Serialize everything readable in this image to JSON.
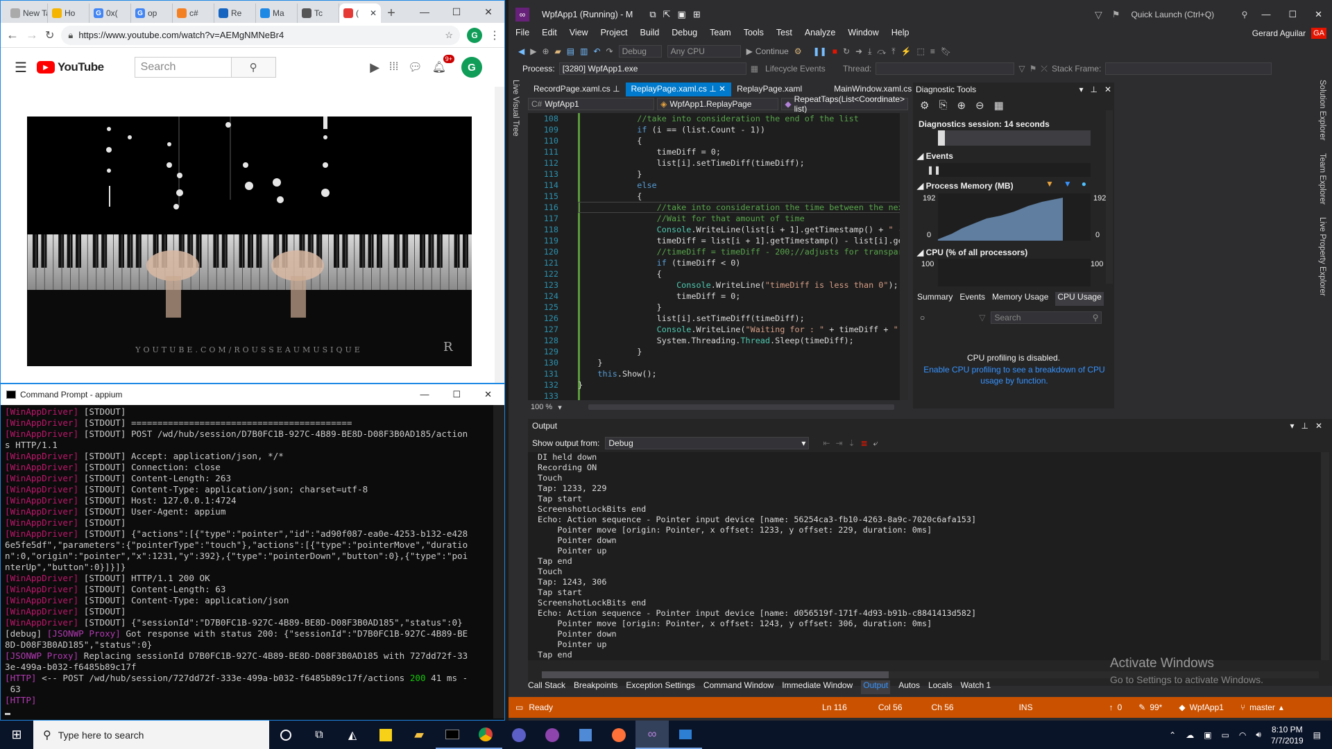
{
  "chrome": {
    "tabs": [
      "New Ta",
      "Ho",
      "0x(",
      "op",
      "c#",
      "Re",
      "Ma",
      "Tc",
      "("
    ],
    "url": "https://www.youtube.com/watch?v=AEMgNMNeBr4",
    "profile_letter": "G"
  },
  "youtube": {
    "logo_text": "YouTube",
    "search_placeholder": "Search",
    "notif_badge": "9+",
    "avatar": "G",
    "video_watermark": "YOUTUBE.COM/ROUSSEAUMUSIQUE"
  },
  "cmd": {
    "title": "Command Prompt - appium",
    "lines": [
      {
        "p": "[WinAppDriver]",
        "t": " [STDOUT]"
      },
      {
        "p": "[WinAppDriver]",
        "t": " [STDOUT] =========================================="
      },
      {
        "p": "[WinAppDriver]",
        "t": " [STDOUT] POST /wd/hub/session/D7B0FC1B-927C-4B89-BE8D-D08F3B0AD185/action"
      },
      {
        "p": "",
        "t": "s HTTP/1.1"
      },
      {
        "p": "[WinAppDriver]",
        "t": " [STDOUT] Accept: application/json, */*"
      },
      {
        "p": "[WinAppDriver]",
        "t": " [STDOUT] Connection: close"
      },
      {
        "p": "[WinAppDriver]",
        "t": " [STDOUT] Content-Length: 263"
      },
      {
        "p": "[WinAppDriver]",
        "t": " [STDOUT] Content-Type: application/json; charset=utf-8"
      },
      {
        "p": "[WinAppDriver]",
        "t": " [STDOUT] Host: 127.0.0.1:4724"
      },
      {
        "p": "[WinAppDriver]",
        "t": " [STDOUT] User-Agent: appium"
      },
      {
        "p": "[WinAppDriver]",
        "t": " [STDOUT]"
      },
      {
        "p": "[WinAppDriver]",
        "t": " [STDOUT] {\"actions\":[{\"type\":\"pointer\",\"id\":\"ad90f087-ea0e-4253-b132-e428"
      },
      {
        "p": "",
        "t": "6e5fe5df\",\"parameters\":{\"pointerType\":\"touch\"},\"actions\":[{\"type\":\"pointerMove\",\"duratio"
      },
      {
        "p": "",
        "t": "n\":0,\"origin\":\"pointer\",\"x\":1231,\"y\":392},{\"type\":\"pointerDown\",\"button\":0},{\"type\":\"poi"
      },
      {
        "p": "",
        "t": "nterUp\",\"button\":0}]}]}"
      },
      {
        "p": "[WinAppDriver]",
        "t": " [STDOUT] HTTP/1.1 200 OK"
      },
      {
        "p": "[WinAppDriver]",
        "t": " [STDOUT] Content-Length: 63"
      },
      {
        "p": "[WinAppDriver]",
        "t": " [STDOUT] Content-Type: application/json"
      },
      {
        "p": "[WinAppDriver]",
        "t": " [STDOUT]"
      },
      {
        "p": "[WinAppDriver]",
        "t": " [STDOUT] {\"sessionId\":\"D7B0FC1B-927C-4B89-BE8D-D08F3B0AD185\",\"status\":0}"
      },
      {
        "p": "[debug]",
        "q": " [JSONWP Proxy]",
        "t": " Got response with status 200: {\"sessionId\":\"D7B0FC1B-927C-4B89-BE"
      },
      {
        "p": "",
        "t": "8D-D08F3B0AD185\",\"status\":0}"
      },
      {
        "p": "",
        "q": "[JSONWP Proxy]",
        "t": " Replacing sessionId D7B0FC1B-927C-4B89-BE8D-D08F3B0AD185 with 727dd72f-33"
      },
      {
        "p": "",
        "t": "3e-499a-b032-f6485b89c17f"
      },
      {
        "p": "",
        "q": "[HTTP]",
        "t": " <-- POST /wd/hub/session/727dd72f-333e-499a-b032-f6485b89c17f/actions ",
        "g": "200",
        "u": " 41 ms -"
      },
      {
        "p": "",
        "t": " 63"
      },
      {
        "p": "",
        "q": "[HTTP]",
        "t": ""
      }
    ]
  },
  "vs": {
    "title": "WpfApp1 (Running) - M",
    "quick_launch": "Quick Launch (Ctrl+Q)",
    "menu": [
      "File",
      "Edit",
      "View",
      "Project",
      "Build",
      "Debug",
      "Team",
      "Tools",
      "Test",
      "Analyze",
      "Window",
      "Help"
    ],
    "user": "Gerard Aguilar",
    "user_initials": "GA",
    "config": "Debug",
    "platform": "Any CPU",
    "continue_label": "Continue",
    "process_label": "Process:",
    "process_value": "[3280] WpfApp1.exe",
    "lifecycle": "Lifecycle Events",
    "thread": "Thread:",
    "stackframe": "Stack Frame:",
    "live_visual_tree": "Live Visual Tree",
    "doc_tabs": [
      "RecordPage.xaml.cs",
      "ReplayPage.xaml.cs",
      "ReplayPage.xaml",
      "MainWindow.xaml.cs"
    ],
    "nav_project": "WpfApp1",
    "nav_class": "WpfApp1.ReplayPage",
    "nav_member": "RepeatTaps(List<Coordinate> list)",
    "zoom": "100 %",
    "line_numbers": [
      "108",
      "109",
      "110",
      "111",
      "112",
      "113",
      "114",
      "115",
      "116",
      "117",
      "118",
      "119",
      "120",
      "121",
      "122",
      "123",
      "124",
      "125",
      "126",
      "127",
      "128",
      "129",
      "130",
      "131",
      "132",
      "133"
    ],
    "diag": {
      "title": "Diagnostic Tools",
      "session": "Diagnostics session: 14 seconds",
      "events": "Events",
      "memory": "Process Memory (MB)",
      "mem_max": "192",
      "mem_min": "0",
      "cpu": "CPU (% of all processors)",
      "cpu_max": "100",
      "tabs": [
        "Summary",
        "Events",
        "Memory Usage",
        "CPU Usage"
      ],
      "search": "Search",
      "disabled": "CPU profiling is disabled.",
      "enable_link": "Enable CPU profiling to see a breakdown of CPU usage by function."
    },
    "right_tabs": [
      "Solution Explorer",
      "Team Explorer",
      "Live Property Explorer"
    ],
    "output": {
      "title": "Output",
      "show_from": "Show output from:",
      "source": "Debug",
      "lines": [
        "DI held down",
        "Recording ON",
        "Touch",
        "Tap: 1233, 229",
        "Tap start",
        "ScreenshotLockBits end",
        "Echo: Action sequence - Pointer input device [name: 56254ca3-fb10-4263-8a9c-7020c6afa153]",
        "    Pointer move [origin: Pointer, x offset: 1233, y offset: 229, duration: 0ms]",
        "    Pointer down",
        "    Pointer up",
        "Tap end",
        "Touch",
        "Tap: 1243, 306",
        "Tap start",
        "ScreenshotLockBits end",
        "Echo: Action sequence - Pointer input device [name: d056519f-171f-4d93-b91b-c8841413d582]",
        "    Pointer move [origin: Pointer, x offset: 1243, y offset: 306, duration: 0ms]",
        "    Pointer down",
        "    Pointer up",
        "Tap end"
      ]
    },
    "bottom_tabs": [
      "Call Stack",
      "Breakpoints",
      "Exception Settings",
      "Command Window",
      "Immediate Window",
      "Output",
      "Autos",
      "Locals",
      "Watch 1"
    ],
    "watermark_title": "Activate Windows",
    "watermark_sub": "Go to Settings to activate Windows.",
    "status": {
      "ready": "Ready",
      "ln": "Ln 116",
      "col": "Col 56",
      "ch": "Ch 56",
      "ins": "INS",
      "up": "0",
      "edits": "99*",
      "repo": "WpfApp1",
      "branch": "master"
    }
  },
  "taskbar": {
    "search_placeholder": "Type here to search",
    "time": "8:10 PM",
    "date": "7/7/2019"
  },
  "colors": {
    "vs_accent": "#007acc",
    "status_bar": "#ca5100",
    "winappdriver": "#c0166c",
    "youtube_red": "#ff0000"
  }
}
